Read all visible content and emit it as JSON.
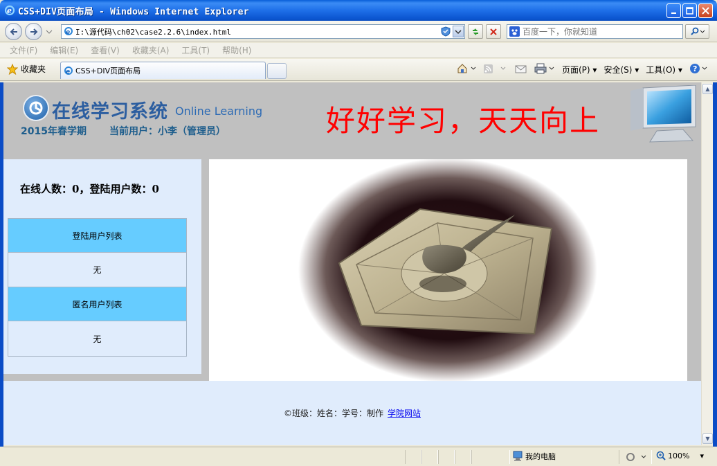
{
  "window": {
    "title": "CSS+DIV页面布局 - Windows Internet Explorer"
  },
  "address": {
    "url": "I:\\源代码\\ch02\\case2.2.6\\index.html"
  },
  "search": {
    "placeholder": "百度一下，你就知道"
  },
  "menu": {
    "items": [
      "文件(F)",
      "编辑(E)",
      "查看(V)",
      "收藏夹(A)",
      "工具(T)",
      "帮助(H)"
    ]
  },
  "favorites": {
    "label": "收藏夹"
  },
  "tab": {
    "title": "CSS+DIV页面布局"
  },
  "commandbar": {
    "page": "页面(P)",
    "safety": "安全(S)",
    "tools": "工具(O)"
  },
  "page": {
    "logo_cn": "在线学习系统",
    "logo_en": "Online Learning",
    "semester": "2015年春学期",
    "current_user": "当前用户：小李（管理员）",
    "slogan": "好好学习，天天向上",
    "online_stats": "在线人数：0，登陆用户数：0",
    "logged_users_header": "登陆用户列表",
    "logged_users_value": "无",
    "anon_users_header": "匿名用户列表",
    "anon_users_value": "无",
    "footer_text": "©班级：姓名：学号：制作",
    "footer_link": "学院网站"
  },
  "status": {
    "zone": "我的电脑",
    "zoom": "100%"
  },
  "colors": {
    "slogan": "#ff0000",
    "header_bg": "#c0c0c0",
    "panel_bg": "#e0ecfc",
    "list_header_bg": "#66ccff"
  }
}
